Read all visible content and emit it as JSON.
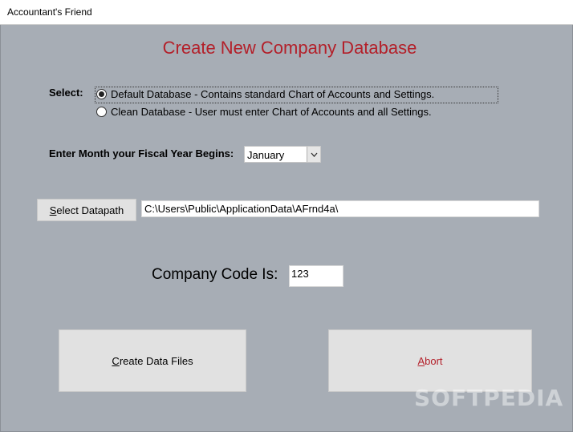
{
  "window": {
    "title": "Accountant's Friend"
  },
  "heading": "Create New Company Database",
  "select_label": "Select:",
  "options": [
    {
      "label": "Default Database - Contains standard Chart of Accounts and Settings.",
      "checked": true
    },
    {
      "label": "Clean Database - User must enter Chart of Accounts and all Settings.",
      "checked": false
    }
  ],
  "fiscal": {
    "label": "Enter Month your Fiscal Year Begins:",
    "value": "January"
  },
  "datapath": {
    "button_mnemonic": "S",
    "button_rest": "elect Datapath",
    "value": "C:\\Users\\Public\\ApplicationData\\AFrnd4a\\"
  },
  "company_code": {
    "label": "Company Code Is:",
    "value": "123"
  },
  "buttons": {
    "create_mnemonic": "C",
    "create_rest": "reate Data Files",
    "abort_mnemonic": "A",
    "abort_rest": "bort"
  },
  "watermark": "SOFTPEDIA",
  "colors": {
    "background": "#a7adb5",
    "heading": "#b3202a",
    "button": "#e1e1e1"
  }
}
